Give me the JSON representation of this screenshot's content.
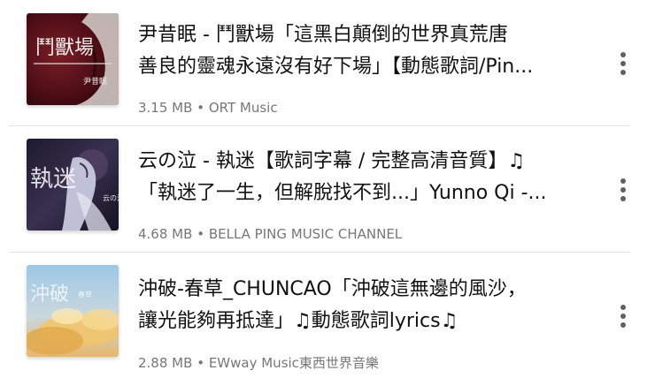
{
  "results": [
    {
      "title_line1": "尹昔眠 - 鬥獸場「這黑白顛倒的世界真荒唐",
      "title_line2": "善良的靈魂永遠沒有好下場」【動態歌詞/Pin...",
      "size": "3.15 MB",
      "separator": "•",
      "channel": "ORT Music",
      "thumb_text": "鬥獸場",
      "thumb_subtext": "尹昔眠"
    },
    {
      "title_line1": "云の泣 - 執迷【歌詞字幕 / 完整高清音質】♫",
      "title_line2": "「執迷了一生，但解脫找不到...」Yunno Qi -...",
      "size": "4.68 MB",
      "separator": "•",
      "channel": "BELLA PING MUSIC CHANNEL",
      "thumb_text": "執迷",
      "thumb_subtext": "云の泣"
    },
    {
      "title_line1": "沖破-春草_CHUNCAO「沖破這無邊的風沙，",
      "title_line2": "讓光能夠再抵達」♫動態歌詞lyrics♫",
      "size": "2.88 MB",
      "separator": "•",
      "channel": "EWway Music東西世界音樂",
      "thumb_text": "沖破",
      "thumb_subtext": "春草"
    }
  ],
  "colors": {
    "title": "#111111",
    "meta": "#777777",
    "divider": "#e3e3e3",
    "kebab": "#606060"
  },
  "icons": {
    "menu": "more-vert-icon"
  }
}
